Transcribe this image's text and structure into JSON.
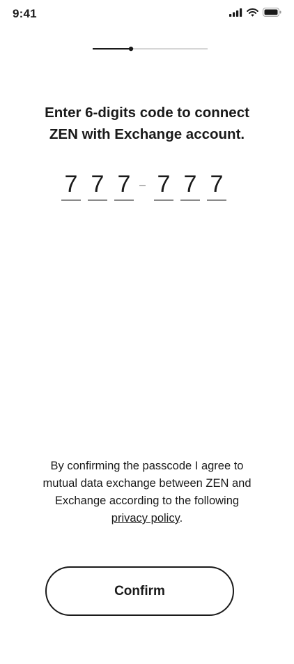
{
  "status_bar": {
    "time": "9:41",
    "icons": [
      "cellular-signal-icon",
      "wifi-icon",
      "battery-icon"
    ]
  },
  "progress": {
    "step": 1,
    "total_steps": 2
  },
  "heading": {
    "line1": "Enter 6-digits code to connect",
    "line2": "ZEN with Exchange account."
  },
  "code": {
    "digits": [
      "7",
      "7",
      "7",
      "7",
      "7",
      "7"
    ],
    "separator": "-"
  },
  "disclaimer": {
    "line1": "By confirming the passcode I agree to",
    "line2": "mutual data exchange between ZEN and",
    "line3": "Exchange according to the following",
    "link_text": "privacy policy",
    "end_punct": "."
  },
  "confirm_button": {
    "label": "Confirm"
  },
  "colors": {
    "text": "#1a1a1a",
    "progress_done": "#1a1a1a",
    "progress_remaining": "#d6d6d6",
    "digit_underline": "#8a8a8a"
  }
}
